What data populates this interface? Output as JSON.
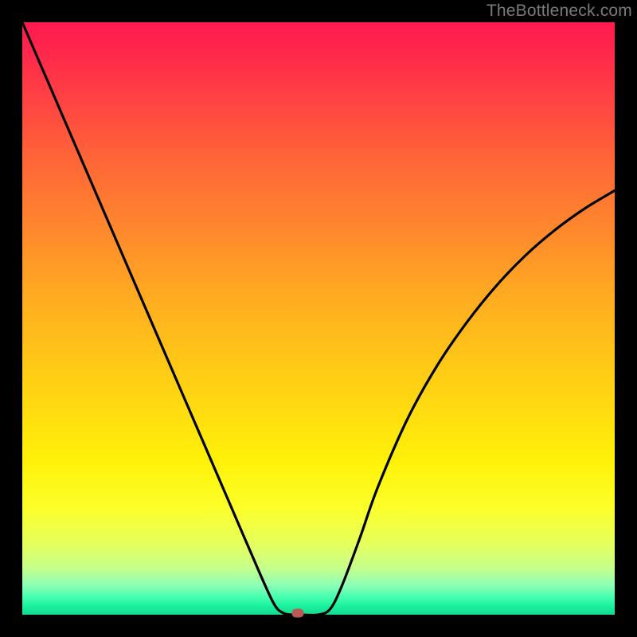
{
  "watermark": "TheBottleneck.com",
  "chart_data": {
    "type": "line",
    "title": "",
    "xlabel": "",
    "ylabel": "",
    "xlim": [
      0,
      1
    ],
    "ylim": [
      0,
      1
    ],
    "series": [
      {
        "name": "bottleneck-curve",
        "x": [
          0.0,
          0.05,
          0.1,
          0.15,
          0.2,
          0.25,
          0.3,
          0.35,
          0.4,
          0.425,
          0.44,
          0.455,
          0.47,
          0.5,
          0.52,
          0.54,
          0.57,
          0.6,
          0.65,
          0.7,
          0.75,
          0.8,
          0.85,
          0.9,
          0.95,
          1.0
        ],
        "values": [
          1.0,
          0.884,
          0.768,
          0.652,
          0.536,
          0.42,
          0.304,
          0.188,
          0.072,
          0.018,
          0.003,
          0.0,
          0.0,
          0.0,
          0.01,
          0.05,
          0.13,
          0.215,
          0.33,
          0.42,
          0.493,
          0.555,
          0.607,
          0.65,
          0.686,
          0.716
        ]
      }
    ],
    "marker": {
      "x": 0.465,
      "y": 0.0,
      "color": "#bb5a55"
    },
    "gradient_stops": [
      {
        "pos": 0.0,
        "color": "#ff1a4f"
      },
      {
        "pos": 0.5,
        "color": "#ffd313"
      },
      {
        "pos": 0.82,
        "color": "#fcff2a"
      },
      {
        "pos": 1.0,
        "color": "#13d98f"
      }
    ]
  }
}
